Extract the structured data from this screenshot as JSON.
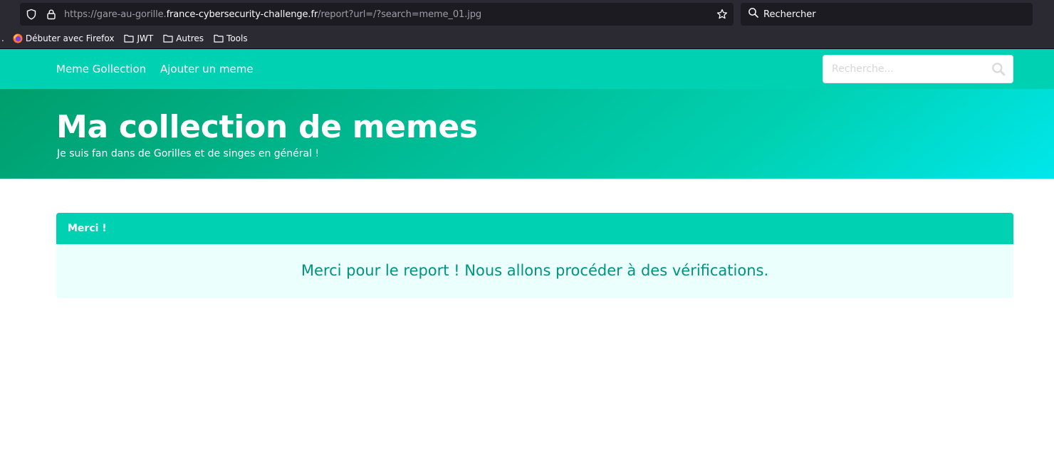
{
  "browser": {
    "url_prefix": "https://gare-au-gorille.",
    "url_host": "france-cybersecurity-challenge.fr",
    "url_path": "/report?url=/?search=meme_01.jpg",
    "search_placeholder": "Rechercher",
    "bookmarks_overflow": ".",
    "bookmarks": [
      {
        "label": "Débuter avec Firefox",
        "icon": "firefox-icon"
      },
      {
        "label": "JWT",
        "icon": "folder-icon"
      },
      {
        "label": "Autres",
        "icon": "folder-icon"
      },
      {
        "label": "Tools",
        "icon": "folder-icon"
      }
    ]
  },
  "navbar": {
    "brand": "Meme Gollection",
    "add_link": "Ajouter un meme",
    "search_placeholder": "Recherche..."
  },
  "hero": {
    "title": "Ma collection de memes",
    "subtitle": "Je suis fan dans de Gorilles et de singes en général !"
  },
  "message": {
    "header": "Merci !",
    "body": "Merci pour le report ! Nous allons procéder à des vérifications."
  },
  "colors": {
    "primary": "#00d1b2",
    "message_bg": "#ebfffc",
    "message_text": "#00947e",
    "chrome_bg": "#2b2a33"
  }
}
